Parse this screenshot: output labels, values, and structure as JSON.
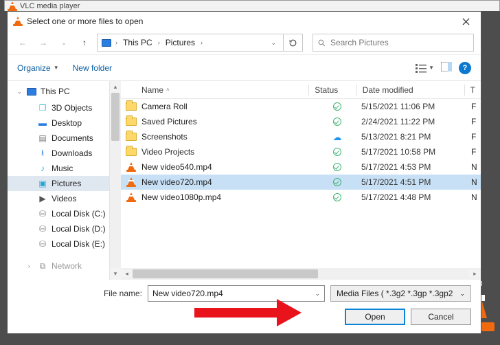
{
  "parent_app": {
    "title": "VLC media player"
  },
  "dialog": {
    "title": "Select one or more files to open",
    "breadcrumb": {
      "root": "This PC",
      "folder": "Pictures"
    },
    "search": {
      "placeholder": "Search Pictures"
    },
    "organize": "Organize",
    "new_folder": "New folder",
    "sidebar": {
      "items": [
        {
          "label": "This PC",
          "icon": "pc",
          "expandable": true
        },
        {
          "label": "3D Objects",
          "icon": "cube"
        },
        {
          "label": "Desktop",
          "icon": "desk"
        },
        {
          "label": "Documents",
          "icon": "doc"
        },
        {
          "label": "Downloads",
          "icon": "dl"
        },
        {
          "label": "Music",
          "icon": "music"
        },
        {
          "label": "Pictures",
          "icon": "pic",
          "selected": true
        },
        {
          "label": "Videos",
          "icon": "vid"
        },
        {
          "label": "Local Disk (C:)",
          "icon": "disk"
        },
        {
          "label": "Local Disk (D:)",
          "icon": "disk"
        },
        {
          "label": "Local Disk (E:)",
          "icon": "disk"
        },
        {
          "label": "Network",
          "icon": "net",
          "dim": true,
          "expandable": true
        }
      ]
    },
    "columns": {
      "name": "Name",
      "status": "Status",
      "date": "Date modified",
      "type": "T"
    },
    "files": [
      {
        "name": "Camera Roll",
        "icon": "folder",
        "status": "synced",
        "date": "5/15/2021 11:06 PM",
        "type": "F"
      },
      {
        "name": "Saved Pictures",
        "icon": "folder",
        "status": "synced",
        "date": "2/24/2021 11:22 PM",
        "type": "F"
      },
      {
        "name": "Screenshots",
        "icon": "folder",
        "status": "cloud",
        "date": "5/13/2021 8:21 PM",
        "type": "F"
      },
      {
        "name": "Video Projects",
        "icon": "folder",
        "status": "synced",
        "date": "5/17/2021 10:58 PM",
        "type": "F"
      },
      {
        "name": "New video540.mp4",
        "icon": "vlc",
        "status": "synced",
        "date": "5/17/2021 4:53 PM",
        "type": "N"
      },
      {
        "name": "New video720.mp4",
        "icon": "vlc",
        "status": "synced",
        "date": "5/17/2021 4:51 PM",
        "type": "N",
        "selected": true
      },
      {
        "name": "New video1080p.mp4",
        "icon": "vlc",
        "status": "synced",
        "date": "5/17/2021 4:48 PM",
        "type": "N"
      }
    ],
    "file_name_label": "File name:",
    "file_name_value": "New video720.mp4",
    "filter": "Media Files ( *.3g2 *.3gp *.3gp2",
    "open": "Open",
    "cancel": "Cancel"
  }
}
